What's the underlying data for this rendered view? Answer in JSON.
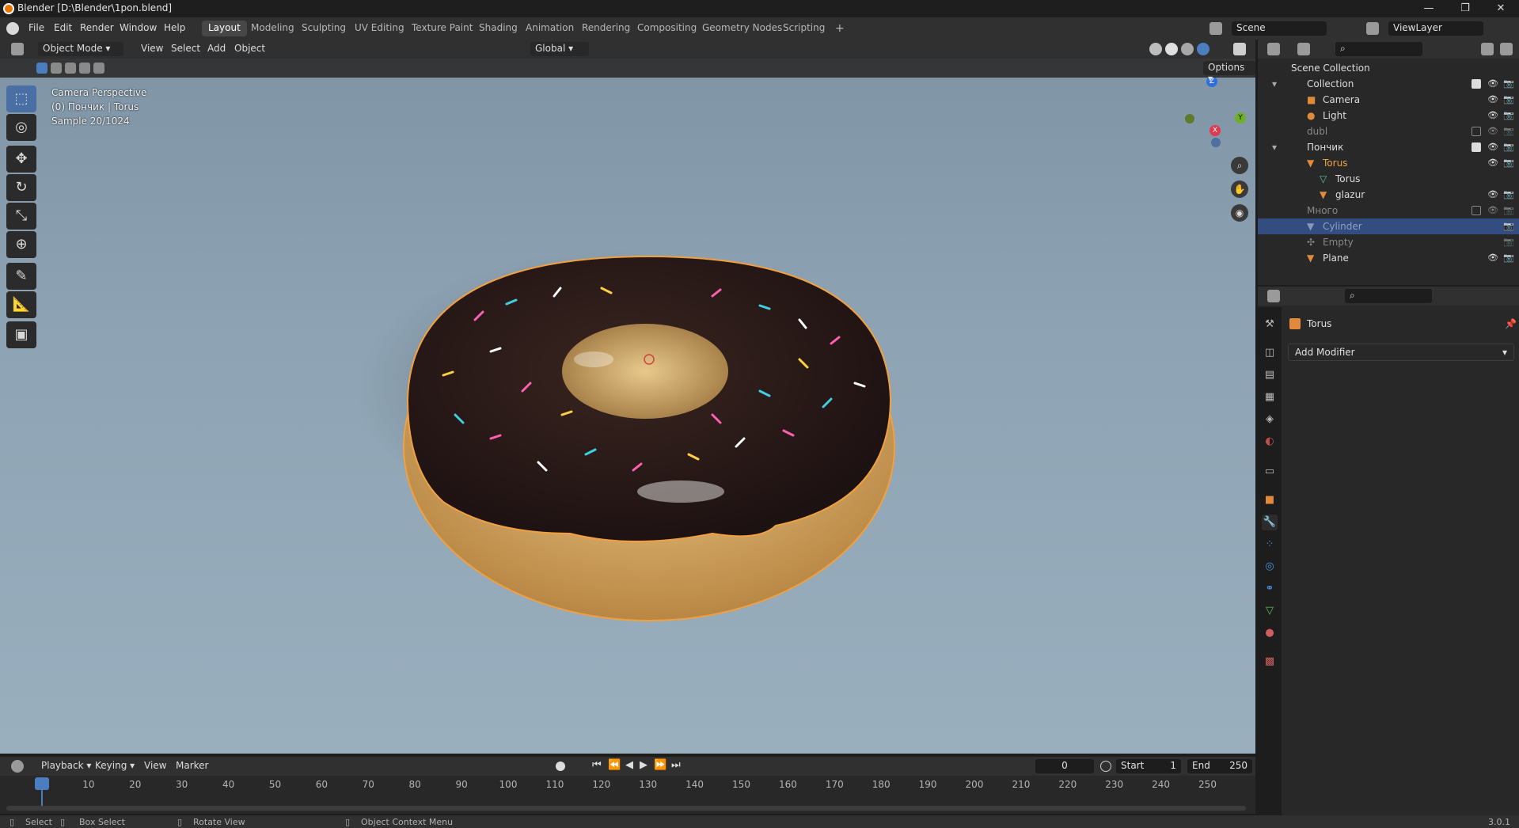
{
  "window": {
    "title": "Blender [D:\\Blender\\1pon.blend]",
    "minimize": "—",
    "maximize": "❐",
    "close": "✕"
  },
  "menu": [
    "File",
    "Edit",
    "Render",
    "Window",
    "Help"
  ],
  "workspaces": [
    "Layout",
    "Modeling",
    "Sculpting",
    "UV Editing",
    "Texture Paint",
    "Shading",
    "Animation",
    "Rendering",
    "Compositing",
    "Geometry Nodes",
    "Scripting"
  ],
  "active_workspace": "Layout",
  "add_workspace": "+",
  "scene": {
    "name": "Scene",
    "view_layer": "ViewLayer"
  },
  "viewport_header": {
    "mode": "Object Mode",
    "menus": [
      "View",
      "Select",
      "Add",
      "Object"
    ],
    "orientation": "Global",
    "options": "Options"
  },
  "viewport_overlay": {
    "line1": "Camera Perspective",
    "line2": "(0) Пончик | Torus",
    "line3": "Sample 20/1024"
  },
  "gizmo": {
    "z": "Z",
    "y": "Y",
    "x": "X"
  },
  "outliner": {
    "root": "Scene Collection",
    "rows": [
      {
        "label": "Collection",
        "indent": 1,
        "checked": true
      },
      {
        "label": "Camera",
        "indent": 2
      },
      {
        "label": "Light",
        "indent": 2
      },
      {
        "label": "dubl",
        "indent": 1,
        "checked": false,
        "dim": true
      },
      {
        "label": "Пончик",
        "indent": 1,
        "checked": true
      },
      {
        "label": "Torus",
        "indent": 2,
        "orange": true
      },
      {
        "label": "Torus",
        "indent": 3
      },
      {
        "label": "glazur",
        "indent": 3
      },
      {
        "label": "Много",
        "indent": 1,
        "checked": false,
        "dim": true
      },
      {
        "label": "Cylinder",
        "indent": 1,
        "selected": true,
        "dim": true
      },
      {
        "label": "Empty",
        "indent": 1,
        "dim": true
      },
      {
        "label": "Plane",
        "indent": 1
      }
    ]
  },
  "properties": {
    "object_name": "Torus",
    "add_modifier": "Add Modifier"
  },
  "timeline": {
    "menus": [
      "Playback",
      "Keying",
      "View",
      "Marker"
    ],
    "current_frame": "0",
    "start_label": "Start",
    "start": "1",
    "end_label": "End",
    "end": "250",
    "ticks": [
      "0",
      "10",
      "20",
      "30",
      "40",
      "50",
      "60",
      "70",
      "80",
      "90",
      "100",
      "110",
      "120",
      "130",
      "140",
      "150",
      "160",
      "170",
      "180",
      "190",
      "200",
      "210",
      "220",
      "230",
      "240",
      "250"
    ]
  },
  "status": {
    "select": "Select",
    "box_select": "Box Select",
    "rotate_view": "Rotate View",
    "context_menu": "Object Context Menu",
    "version": "3.0.1"
  }
}
